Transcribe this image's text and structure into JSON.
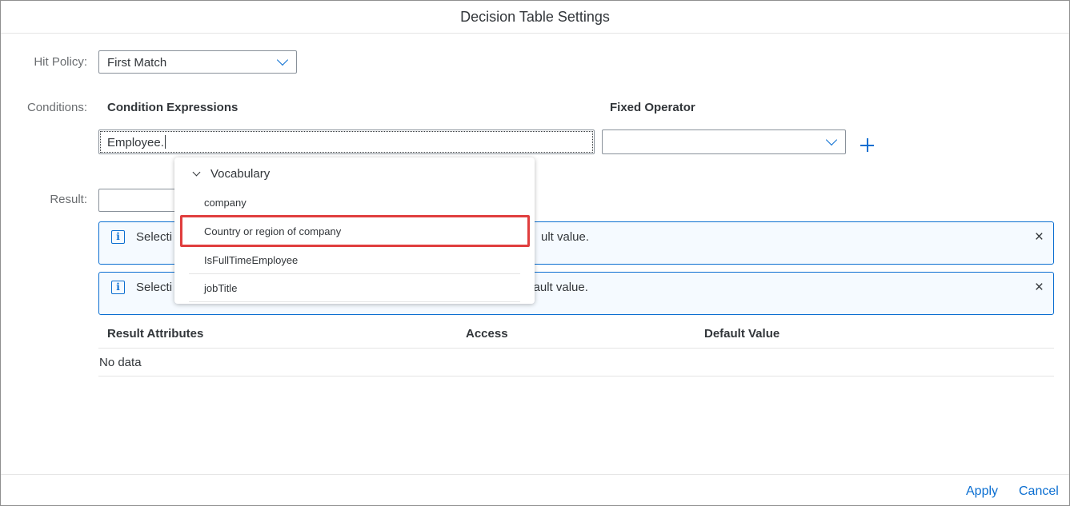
{
  "dialog": {
    "title": "Decision Table Settings"
  },
  "hit_policy": {
    "label": "Hit Policy:",
    "value": "First Match"
  },
  "conditions": {
    "label": "Conditions:",
    "expressions_header": "Condition Expressions",
    "operator_header": "Fixed Operator",
    "expression_value": "Employee.",
    "operator_value": ""
  },
  "result": {
    "label": "Result:",
    "value": ""
  },
  "messages": [
    {
      "text_start": "Selecti",
      "text_end": "ult value."
    },
    {
      "text_start": "Selecti",
      "text_end": "efault value."
    }
  ],
  "table": {
    "columns": [
      "Result Attributes",
      "Access",
      "Default Value"
    ],
    "empty_text": "No data"
  },
  "suggestions": {
    "group_label": "Vocabulary",
    "items": [
      "company",
      "Country or region of company",
      "IsFullTimeEmployee",
      "jobTitle"
    ],
    "highlighted_item": "Country or region of company"
  },
  "footer": {
    "apply_label": "Apply",
    "cancel_label": "Cancel"
  },
  "colors": {
    "accent": "#0a6ed1",
    "highlight": "#e03e3e",
    "text": "#32363a",
    "label": "#6a6d70"
  },
  "icons": {
    "dropdown": "chevron-down-icon",
    "add": "plus-icon",
    "info": "info-icon",
    "close": "close-icon"
  }
}
